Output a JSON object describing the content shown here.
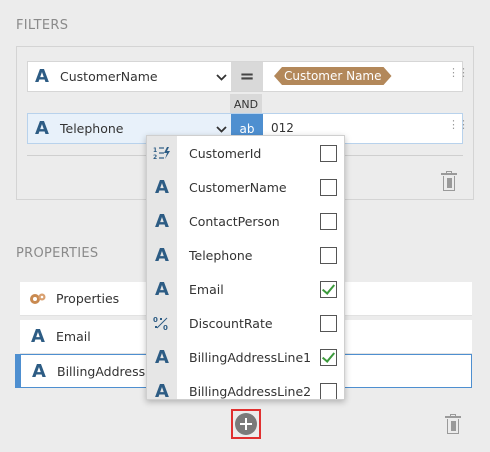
{
  "filters": {
    "title": "FILTERS",
    "and_label": "AND",
    "rows": [
      {
        "field": "CustomerName",
        "operator": "=",
        "value": "Customer Name"
      },
      {
        "field": "Telephone",
        "operator": "ab",
        "value": "012"
      }
    ]
  },
  "properties": {
    "title": "PROPERTIES",
    "items": [
      {
        "label": "Properties",
        "icon": "properties-icon"
      },
      {
        "label": "Email",
        "icon": "text-type-icon"
      },
      {
        "label": "BillingAddressLi",
        "icon": "text-type-icon",
        "selected": true
      }
    ]
  },
  "dropdown": {
    "items": [
      {
        "label": "CustomerId",
        "icon": "numeric-id-icon",
        "checked": false
      },
      {
        "label": "CustomerName",
        "icon": "text-type-icon",
        "checked": false
      },
      {
        "label": "ContactPerson",
        "icon": "text-type-icon",
        "checked": false
      },
      {
        "label": "Telephone",
        "icon": "text-type-icon",
        "checked": false
      },
      {
        "label": "Email",
        "icon": "text-type-icon",
        "checked": true
      },
      {
        "label": "DiscountRate",
        "icon": "decimal-type-icon",
        "checked": false
      },
      {
        "label": "BillingAddressLine1",
        "icon": "text-type-icon",
        "checked": true
      },
      {
        "label": "BillingAddressLine2",
        "icon": "text-type-icon",
        "checked": false
      }
    ]
  },
  "type_glyph": "A",
  "colors": {
    "accent": "#4e8fd0",
    "type_icon": "#2d5c84",
    "tag": "#b3885a",
    "highlight_border": "#e03030",
    "check": "#3c9a3c"
  }
}
